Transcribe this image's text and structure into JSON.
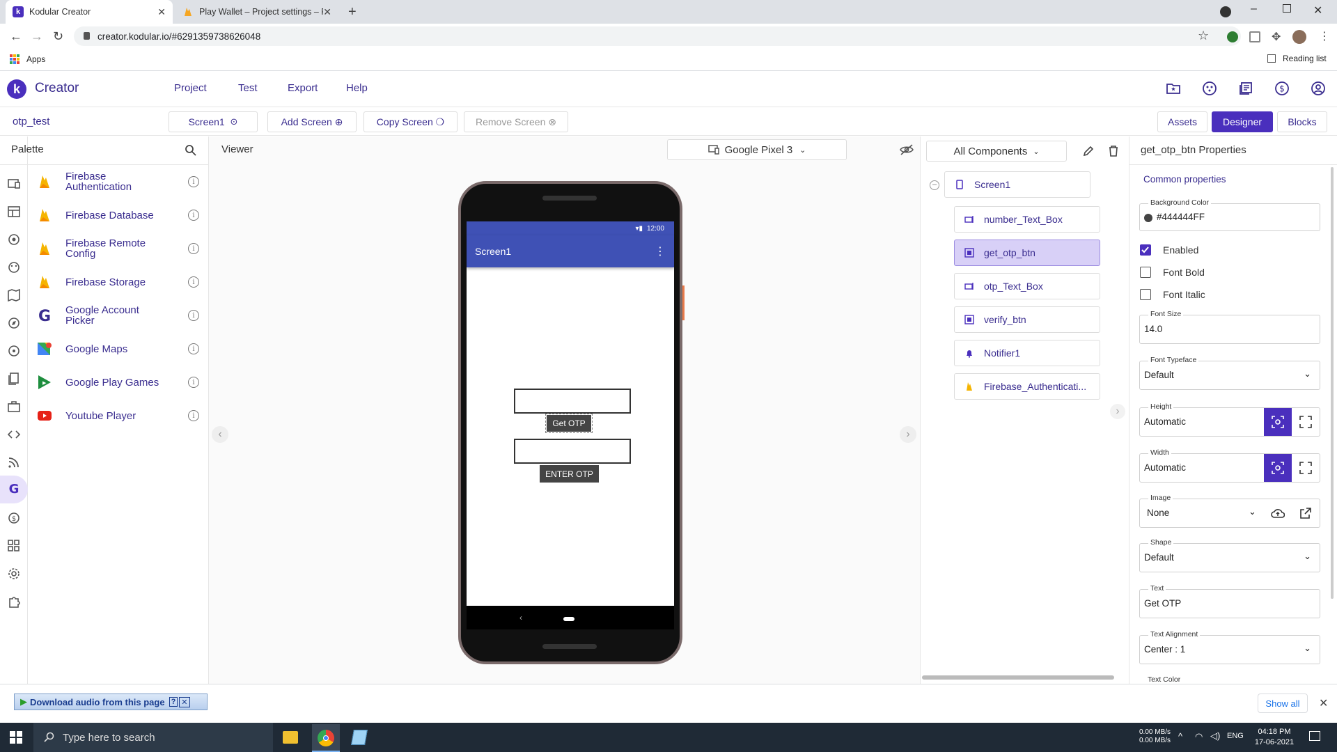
{
  "browser": {
    "tabs": [
      {
        "title": "Kodular Creator",
        "active": true
      },
      {
        "title": "Play Wallet – Project settings – Fi",
        "active": false
      }
    ],
    "url": "creator.kodular.io/#6291359738626048",
    "bookmarks": {
      "apps": "Apps",
      "reading_list": "Reading list"
    }
  },
  "header": {
    "brand": "Creator",
    "menus": [
      "Project",
      "Test",
      "Export",
      "Help"
    ]
  },
  "project": {
    "name": "otp_test"
  },
  "screenbar": {
    "current_screen": "Screen1",
    "add": "Add Screen",
    "copy": "Copy Screen",
    "remove": "Remove Screen",
    "assets": "Assets",
    "designer": "Designer",
    "blocks": "Blocks"
  },
  "palette": {
    "title": "Palette",
    "items": [
      {
        "label": "Firebase Authentication",
        "icon": "firebase-icon"
      },
      {
        "label": "Firebase Database",
        "icon": "firebase-icon"
      },
      {
        "label": "Firebase Remote Config",
        "icon": "firebase-icon"
      },
      {
        "label": "Firebase Storage",
        "icon": "firebase-icon"
      },
      {
        "label": "Google Account Picker",
        "icon": "google-icon"
      },
      {
        "label": "Google Maps",
        "icon": "maps-icon"
      },
      {
        "label": "Google Play Games",
        "icon": "play-games-icon"
      },
      {
        "label": "Youtube Player",
        "icon": "youtube-icon"
      }
    ]
  },
  "viewer": {
    "title": "Viewer",
    "device": "Google Pixel 3",
    "phone": {
      "time": "12:00",
      "screen_title": "Screen1",
      "button1": "Get OTP",
      "button2": "ENTER OTP"
    }
  },
  "components": {
    "filter": "All Components",
    "root": "Screen1",
    "items": [
      {
        "label": "number_Text_Box",
        "icon": "textbox-icon",
        "selected": false
      },
      {
        "label": "get_otp_btn",
        "icon": "button-icon",
        "selected": true
      },
      {
        "label": "otp_Text_Box",
        "icon": "textbox-icon",
        "selected": false
      },
      {
        "label": "verify_btn",
        "icon": "button-icon",
        "selected": false
      },
      {
        "label": "Notifier1",
        "icon": "bell-icon",
        "selected": false
      },
      {
        "label": "Firebase_Authenticati...",
        "icon": "firebase-icon",
        "selected": false
      }
    ]
  },
  "properties": {
    "title": "get_otp_btn Properties",
    "section": "Common properties",
    "background_color": {
      "label": "Background Color",
      "value": "#444444FF"
    },
    "enabled": {
      "label": "Enabled",
      "checked": true
    },
    "font_bold": {
      "label": "Font Bold",
      "checked": false
    },
    "font_italic": {
      "label": "Font Italic",
      "checked": false
    },
    "font_size": {
      "label": "Font Size",
      "value": "14.0"
    },
    "font_typeface": {
      "label": "Font Typeface",
      "value": "Default"
    },
    "height": {
      "label": "Height",
      "value": "Automatic"
    },
    "width": {
      "label": "Width",
      "value": "Automatic"
    },
    "image": {
      "label": "Image",
      "value": "None"
    },
    "shape": {
      "label": "Shape",
      "value": "Default"
    },
    "text": {
      "label": "Text",
      "value": "Get OTP"
    },
    "text_alignment": {
      "label": "Text Alignment",
      "value": "Center : 1"
    },
    "text_color": {
      "label": "Text Color"
    }
  },
  "download_bar": {
    "extension_label": "Download audio from this page",
    "show_all": "Show all"
  },
  "taskbar": {
    "search_placeholder": "Type here to search",
    "net_up": "0.00 MB/s",
    "net_down": "0.00 MB/s",
    "lang": "ENG",
    "time": "04:18 PM",
    "date": "17-06-2021"
  },
  "colors": {
    "accent": "#4a2fbd",
    "link": "#3a2d8f",
    "appbar": "#3f51b5",
    "button_bg": "#444444"
  }
}
